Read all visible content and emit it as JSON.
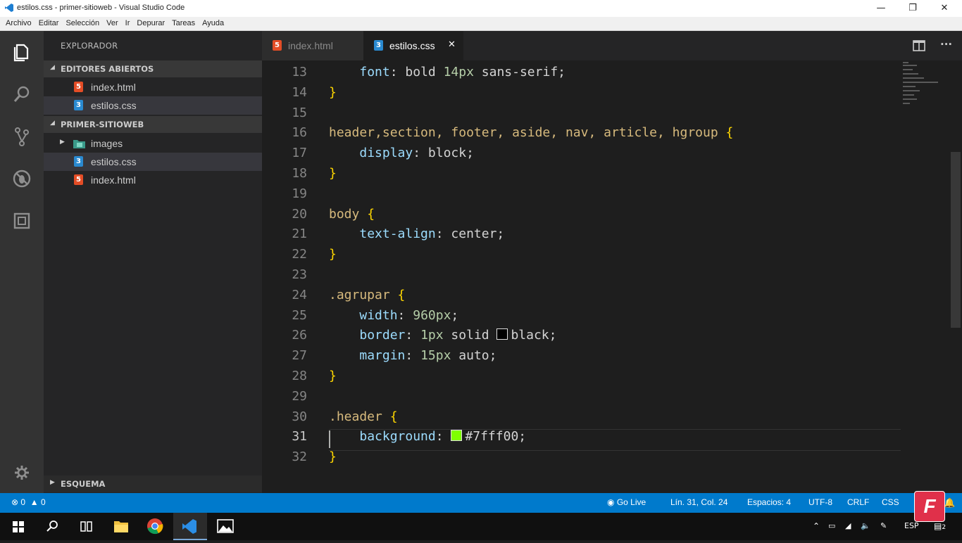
{
  "window": {
    "title": "estilos.css - primer-sitioweb - Visual Studio Code",
    "minimize_glyph": "—",
    "maximize_glyph": "❐",
    "close_glyph": "✕"
  },
  "menu": [
    "Archivo",
    "Editar",
    "Selección",
    "Ver",
    "Ir",
    "Depurar",
    "Tareas",
    "Ayuda"
  ],
  "activity_bar": [
    "explorer-icon",
    "search-icon",
    "source-control-icon",
    "debug-icon",
    "extensions-icon",
    "settings-gear-icon"
  ],
  "sidebar": {
    "title": "EXPLORADOR",
    "open_editors_label": "EDITORES ABIERTOS",
    "open_editors": [
      {
        "label": "index.html",
        "type": "html",
        "badge": "5"
      },
      {
        "label": "estilos.css",
        "type": "css",
        "badge": "3"
      }
    ],
    "folder_label": "PRIMER-SITIOWEB",
    "folder_items": [
      {
        "label": "images",
        "type": "folder"
      },
      {
        "label": "estilos.css",
        "type": "css",
        "badge": "3"
      },
      {
        "label": "index.html",
        "type": "html",
        "badge": "5"
      }
    ],
    "outline_label": "ESQUEMA",
    "expanded_glyph": "◢",
    "collapsed_glyph": "▶"
  },
  "tabs": [
    {
      "label": "index.html",
      "type": "html",
      "badge": "5",
      "active": false
    },
    {
      "label": "estilos.css",
      "type": "css",
      "badge": "3",
      "active": true,
      "close_glyph": "✕"
    }
  ],
  "editor_actions": {
    "split_icon": "split-editor-icon",
    "more_glyph": "···"
  },
  "editor": {
    "current_line": "31",
    "lines": [
      {
        "n": "13",
        "parts": [
          [
            "    ",
            ""
          ],
          [
            "font",
            "prop"
          ],
          [
            ": ",
            ""
          ],
          [
            "bold ",
            "val"
          ],
          [
            "14px",
            "num"
          ],
          [
            " sans-serif;",
            "val"
          ]
        ]
      },
      {
        "n": "14",
        "parts": [
          [
            "}",
            "br"
          ]
        ]
      },
      {
        "n": "15",
        "parts": []
      },
      {
        "n": "16",
        "parts": [
          [
            "header,section, footer, aside, nav, article, hgroup ",
            "sel-c"
          ],
          [
            "{",
            "br"
          ]
        ]
      },
      {
        "n": "17",
        "parts": [
          [
            "    ",
            ""
          ],
          [
            "display",
            "prop"
          ],
          [
            ": block;",
            "val"
          ]
        ]
      },
      {
        "n": "18",
        "parts": [
          [
            "}",
            "br"
          ]
        ]
      },
      {
        "n": "19",
        "parts": []
      },
      {
        "n": "20",
        "parts": [
          [
            "body ",
            "sel-c"
          ],
          [
            "{",
            "br"
          ]
        ]
      },
      {
        "n": "21",
        "parts": [
          [
            "    ",
            ""
          ],
          [
            "text-align",
            "prop"
          ],
          [
            ": center;",
            "val"
          ]
        ]
      },
      {
        "n": "22",
        "parts": [
          [
            "}",
            "br"
          ]
        ]
      },
      {
        "n": "23",
        "parts": []
      },
      {
        "n": "24",
        "parts": [
          [
            ".agrupar ",
            "sel-c"
          ],
          [
            "{",
            "br"
          ]
        ]
      },
      {
        "n": "25",
        "parts": [
          [
            "    ",
            ""
          ],
          [
            "width",
            "prop"
          ],
          [
            ": ",
            "val"
          ],
          [
            "960px",
            "num"
          ],
          [
            ";",
            "val"
          ]
        ]
      },
      {
        "n": "26",
        "parts": [
          [
            "    ",
            ""
          ],
          [
            "border",
            "prop"
          ],
          [
            ": ",
            "val"
          ],
          [
            "1px",
            "num"
          ],
          [
            " solid ",
            "val"
          ],
          [
            "#000000",
            "swatch"
          ],
          [
            "black;",
            "val"
          ]
        ]
      },
      {
        "n": "27",
        "parts": [
          [
            "    ",
            ""
          ],
          [
            "margin",
            "prop"
          ],
          [
            ": ",
            "val"
          ],
          [
            "15px",
            "num"
          ],
          [
            " auto;",
            "val"
          ]
        ]
      },
      {
        "n": "28",
        "parts": [
          [
            "}",
            "br"
          ]
        ]
      },
      {
        "n": "29",
        "parts": []
      },
      {
        "n": "30",
        "parts": [
          [
            ".header ",
            "sel-c"
          ],
          [
            "{",
            "br"
          ]
        ]
      },
      {
        "n": "31",
        "parts": [
          [
            "    ",
            ""
          ],
          [
            "background",
            "prop"
          ],
          [
            ": ",
            "val"
          ],
          [
            "#7fff00",
            "swatch"
          ],
          [
            "#7fff00;",
            "val"
          ]
        ]
      },
      {
        "n": "32",
        "parts": [
          [
            "}",
            "br"
          ]
        ]
      }
    ]
  },
  "status": {
    "errors": "0",
    "warnings": "0",
    "go_live": "Go Live",
    "position": "Lín. 31, Col. 24",
    "spaces": "Espacios: 4",
    "encoding": "UTF-8",
    "eol": "CRLF",
    "language": "CSS"
  },
  "taskbar": {
    "apps": [
      "windows-start-icon",
      "search-icon",
      "task-view-icon",
      "file-explorer-icon",
      "chrome-icon",
      "vscode-icon",
      "photos-icon"
    ],
    "tray_lang": "ESP",
    "notification_count": "2",
    "watermark_letter": "F"
  },
  "colors": {
    "accent": "#007acc",
    "html_icon": "#e44d26",
    "css_icon": "#2a8ad1",
    "selector": "#d7ba7d",
    "property": "#9cdcfe",
    "number": "#b5cea8",
    "bracket": "#ffd700"
  }
}
